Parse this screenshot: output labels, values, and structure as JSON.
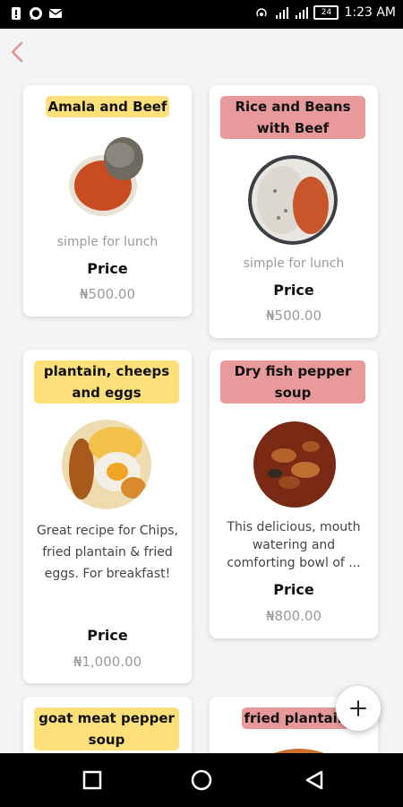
{
  "status_bar": {
    "time": "1:23 AM",
    "battery": "24",
    "left_icons": [
      "sim-alert-icon",
      "whatsapp-icon",
      "mail-icon"
    ],
    "right_icons": [
      "hotspot-icon",
      "signal-icon",
      "signal-icon"
    ]
  },
  "nav": {
    "back_icon": "chevron-left-icon",
    "accent": "#e88f8f"
  },
  "items": [
    {
      "title": "Amala and Beef",
      "tag_color": "#fde07a",
      "description": "simple for lunch",
      "price_label": "Price",
      "price": "₦500.00"
    },
    {
      "title": "Rice and Beans with Beef",
      "tag_color": "#e89a9a",
      "description": "simple for lunch",
      "price_label": "Price",
      "price": "₦500.00"
    },
    {
      "title": "plantain, cheeps and eggs",
      "tag_color": "#fde07a",
      "description": "Great recipe for Chips, fried plantain & fried eggs. For breakfast!",
      "price_label": "Price",
      "price": "₦1,000.00"
    },
    {
      "title": "Dry fish pepper soup",
      "tag_color": "#e89a9a",
      "description": "This delicious, mouth watering and comforting bowl of ...",
      "price_label": "Price",
      "price": "₦800.00"
    },
    {
      "title": "goat meat pepper soup",
      "tag_color": "#fde07a"
    },
    {
      "title": "fried plantain",
      "tag_color": "#e89a9a"
    }
  ],
  "fab": {
    "icon": "plus-icon"
  },
  "bottom_nav": [
    "square-icon",
    "circle-icon",
    "triangle-back-icon"
  ]
}
